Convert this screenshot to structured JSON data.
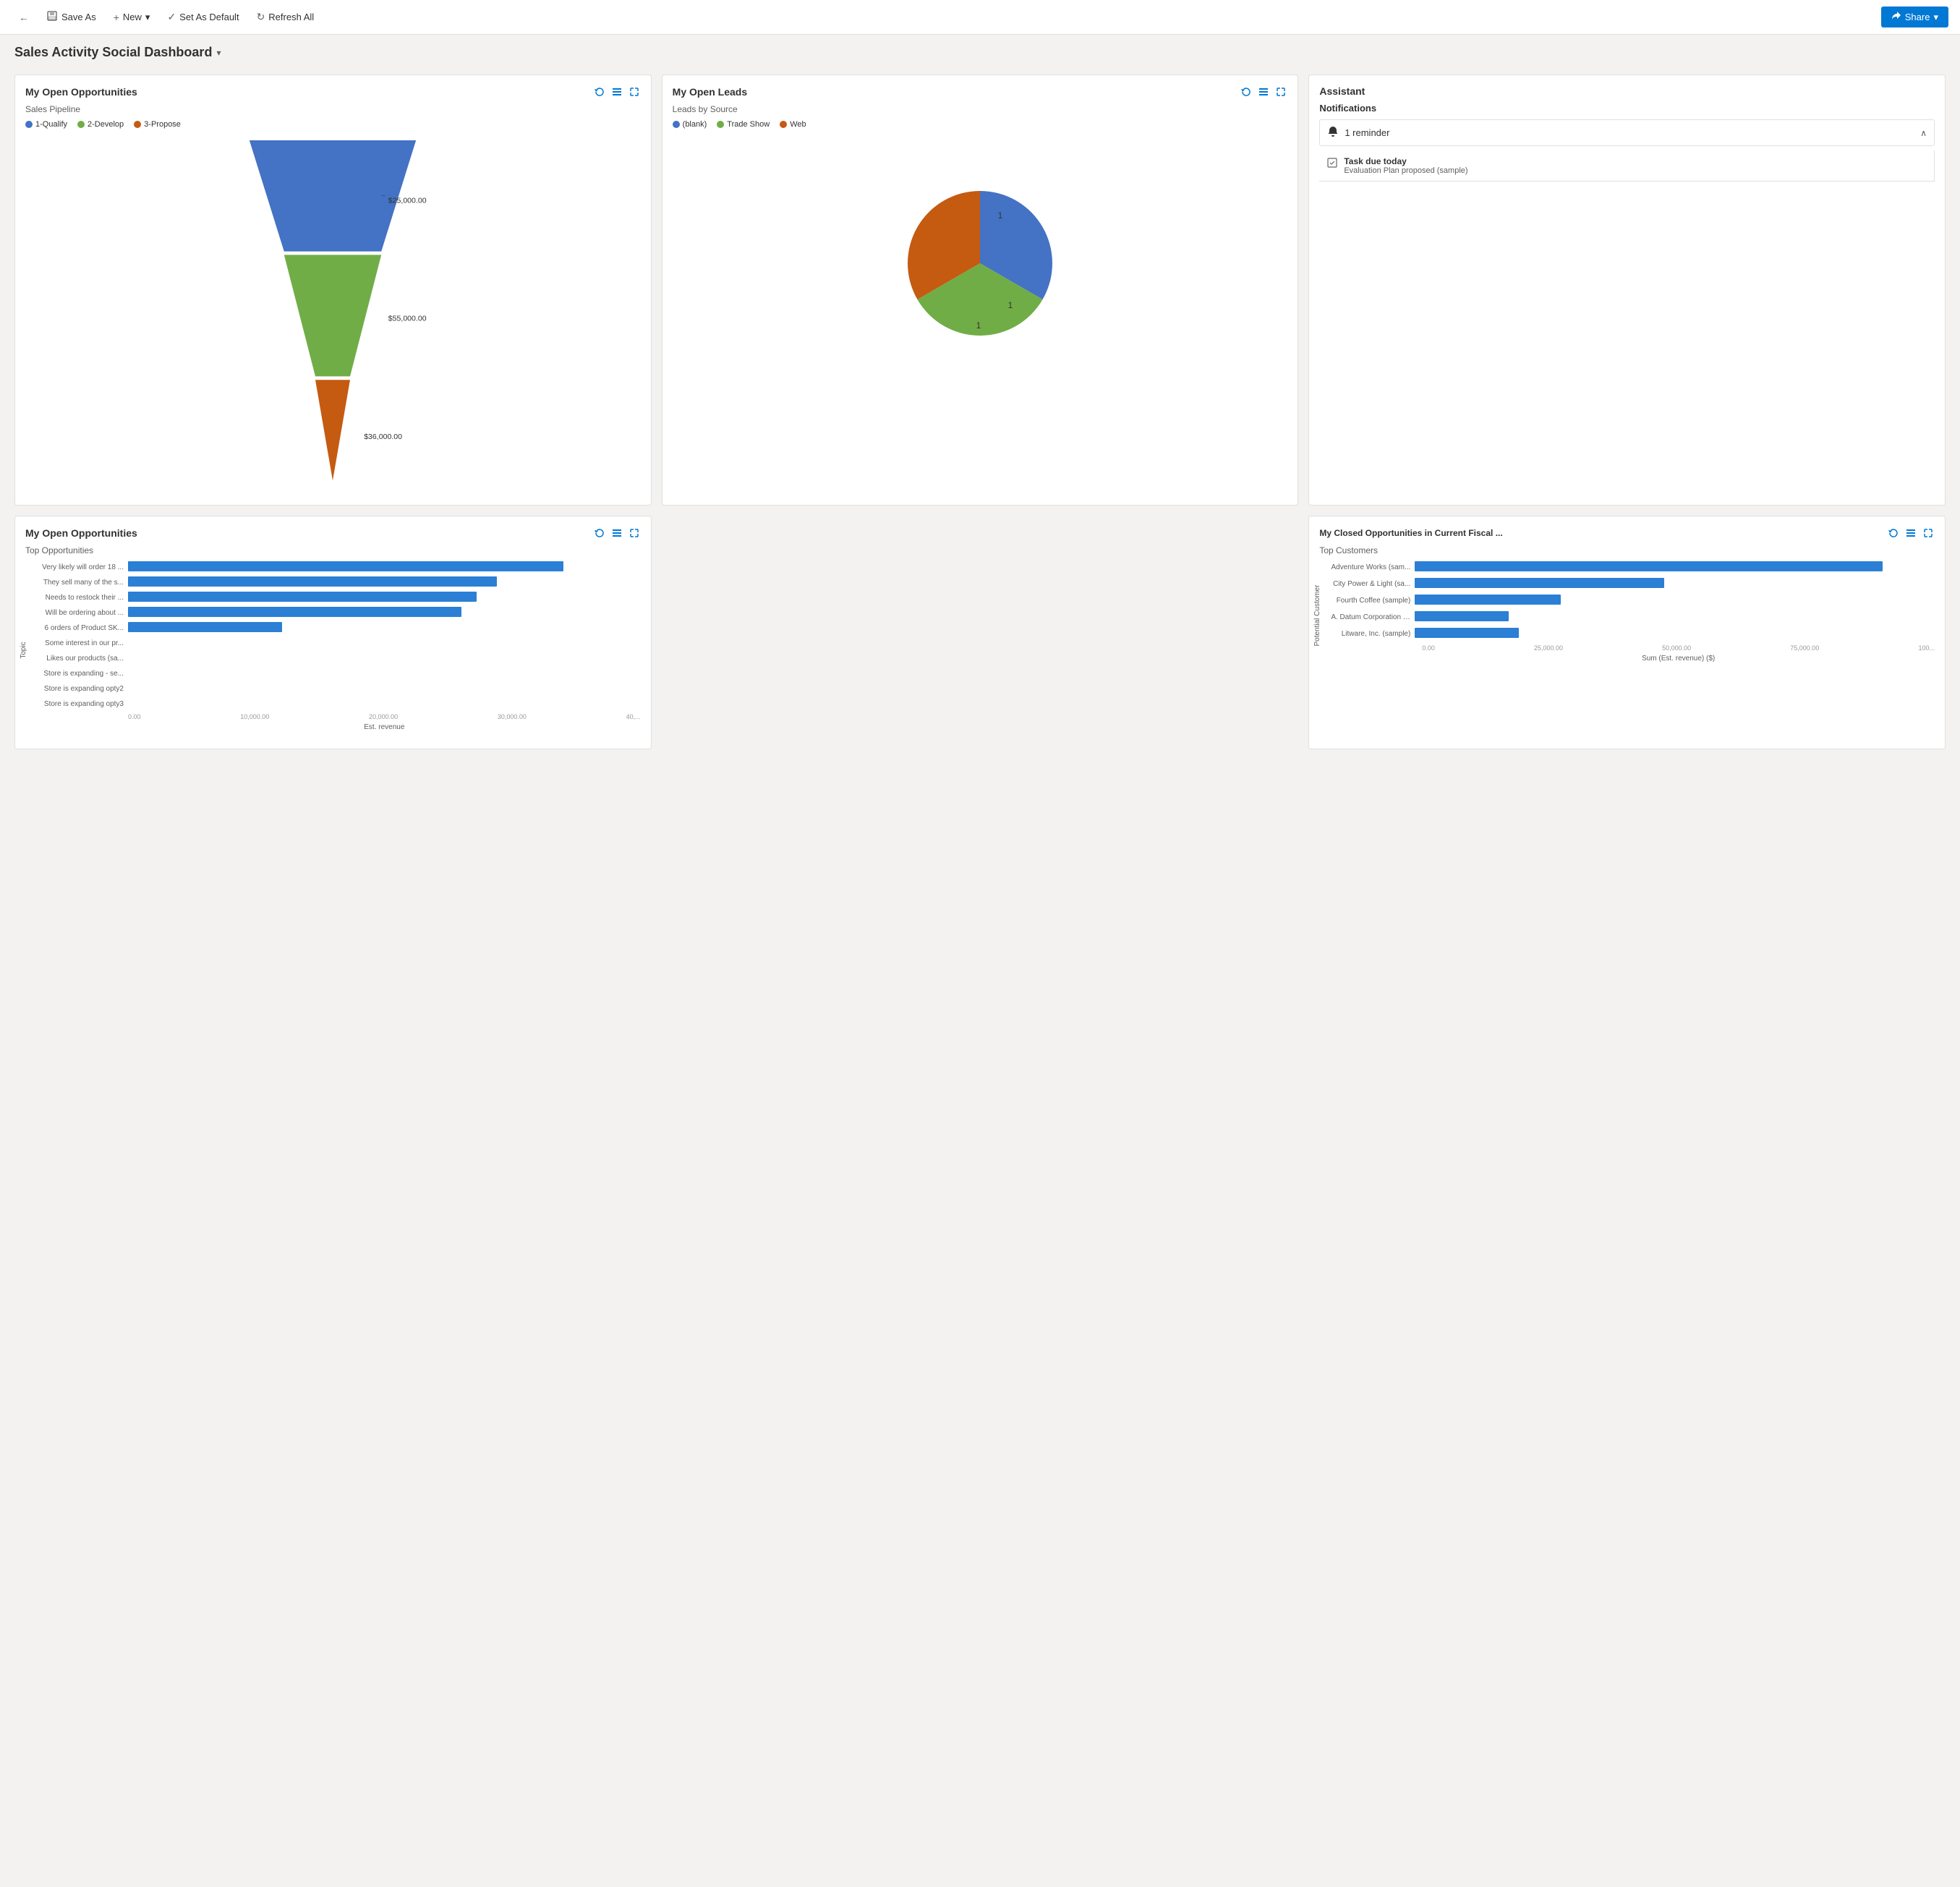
{
  "toolbar": {
    "back_icon": "←",
    "save_as_icon": "💾",
    "save_as_label": "Save As",
    "new_icon": "+",
    "new_label": "New",
    "new_caret": "▾",
    "set_default_icon": "✓",
    "set_default_label": "Set As Default",
    "refresh_icon": "↻",
    "refresh_label": "Refresh All",
    "share_icon": "↗",
    "share_label": "Share",
    "share_caret": "▾"
  },
  "page": {
    "title": "Sales Activity Social Dashboard",
    "caret": "▾"
  },
  "cards": {
    "open_opportunities": {
      "title": "My Open Opportunities",
      "subtitle": "Sales Pipeline",
      "legend": [
        {
          "label": "1-Qualify",
          "color": "#4472c4"
        },
        {
          "label": "2-Develop",
          "color": "#70ad47"
        },
        {
          "label": "3-Propose",
          "color": "#c55a11"
        }
      ],
      "funnel": [
        {
          "label": "$25,000.00",
          "color": "#4472c4",
          "pct": 100
        },
        {
          "label": "$55,000.00",
          "color": "#70ad47",
          "pct": 72
        },
        {
          "label": "$36,000.00",
          "color": "#c55a11",
          "pct": 35
        }
      ]
    },
    "open_leads": {
      "title": "My Open Leads",
      "subtitle": "Leads by Source",
      "legend": [
        {
          "label": "(blank)",
          "color": "#4472c4"
        },
        {
          "label": "Trade Show",
          "color": "#70ad47"
        },
        {
          "label": "Web",
          "color": "#c55a11"
        }
      ],
      "pie_segments": [
        {
          "label": "blank",
          "value": 1,
          "color": "#4472c4",
          "start_angle": 0,
          "sweep": 120
        },
        {
          "label": "Trade Show",
          "value": 1,
          "color": "#70ad47",
          "start_angle": 120,
          "sweep": 120
        },
        {
          "label": "Web",
          "value": 1,
          "color": "#c55a11",
          "start_angle": 240,
          "sweep": 120
        }
      ]
    },
    "assistant": {
      "title": "Assistant",
      "notifications_label": "Notifications",
      "reminder_count": "1 reminder",
      "task_title": "Task due today",
      "task_desc": "Evaluation Plan proposed (sample)"
    },
    "top_opportunities": {
      "title": "My Open Opportunities",
      "subtitle": "Top Opportunities",
      "y_axis_label": "Topic",
      "x_axis_label": "Est. revenue",
      "bars": [
        {
          "label": "Very likely will order 18 ...",
          "value": 85
        },
        {
          "label": "They sell many of the s...",
          "value": 72
        },
        {
          "label": "Needs to restock their ...",
          "value": 68
        },
        {
          "label": "Will be ordering about ...",
          "value": 65
        },
        {
          "label": "6 orders of Product SK...",
          "value": 30
        },
        {
          "label": "Some interest in our pr...",
          "value": 0
        },
        {
          "label": "Likes our products (sa...",
          "value": 0
        },
        {
          "label": "Store is expanding - se...",
          "value": 0
        },
        {
          "label": "Store is expanding opty2",
          "value": 0
        },
        {
          "label": "Store is expanding opty3",
          "value": 0
        }
      ],
      "x_axis_ticks": [
        "0.00",
        "10,000.00",
        "20,000.00",
        "30,000.00",
        "40,..."
      ]
    },
    "closed_opportunities": {
      "title": "My Closed Opportunities in Current Fiscal ...",
      "subtitle": "Top Customers",
      "y_axis_label": "Potential Customer",
      "x_axis_label": "Sum (Est. revenue) ($)",
      "bars": [
        {
          "label": "Adventure Works (sam...",
          "value": 90
        },
        {
          "label": "City Power & Light (sa...",
          "value": 48
        },
        {
          "label": "Fourth Coffee (sample)",
          "value": 28
        },
        {
          "label": "A. Datum Corporation (...",
          "value": 18
        },
        {
          "label": "Litware, Inc. (sample)",
          "value": 20
        }
      ],
      "x_axis_ticks": [
        "0.00",
        "25,000.00",
        "50,000.00",
        "75,000.00",
        "100..."
      ]
    }
  }
}
